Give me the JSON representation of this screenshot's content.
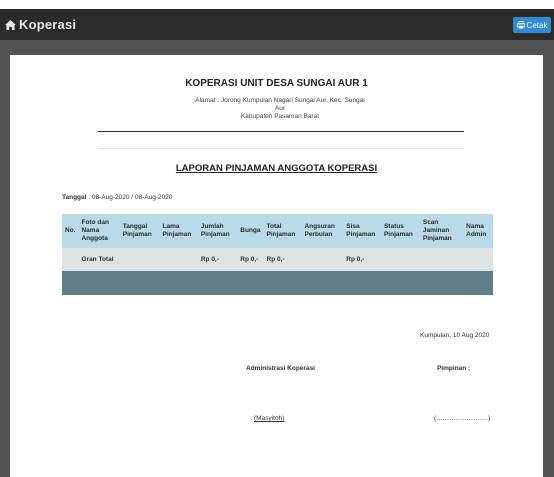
{
  "app": {
    "title": "Koperasi",
    "print_label": "Cetak"
  },
  "report": {
    "org_title": "KOPERASI UNIT DESA SUNGAI AUR 1",
    "address_line1": "Alamat : Jorong Kumpulan Nagari Sungai Aur, Kec. Sungai Aur",
    "address_line2": "Kabupaten Pasaman Barat",
    "report_title": "LAPORAN PINJAMAN ANGGOTA KOPERASI",
    "date_label": "Tanggal",
    "date_range": " : 08-Aug-2020 / 08-Aug-2020"
  },
  "table": {
    "columns": [
      "No.",
      "Foto dan Nama Anggota",
      "Tanggal Pinjaman",
      "Lama Pinjaman",
      "Jumlah Pinjaman",
      "Bunga",
      "Total Pinjaman",
      "Angsuran Perbulan",
      "Sisa Pinjaman",
      "Status Pinjaman",
      "Scan Jaminan Pinjaman",
      "Nama Admin"
    ],
    "total_row": [
      "",
      "Gran Total",
      "",
      "",
      "Rp 0,-",
      "Rp 0,-",
      "Rp 0,-",
      "",
      "Rp 0,-",
      "",
      "",
      ""
    ]
  },
  "signature": {
    "place_date": "Kumpulan, 10 Aug 2020",
    "admin_title": "Administrasi Koperasi",
    "leader_title": "Pimpinan :",
    "admin_name": "(Masyitoh)",
    "leader_blank": "(……………………)"
  }
}
